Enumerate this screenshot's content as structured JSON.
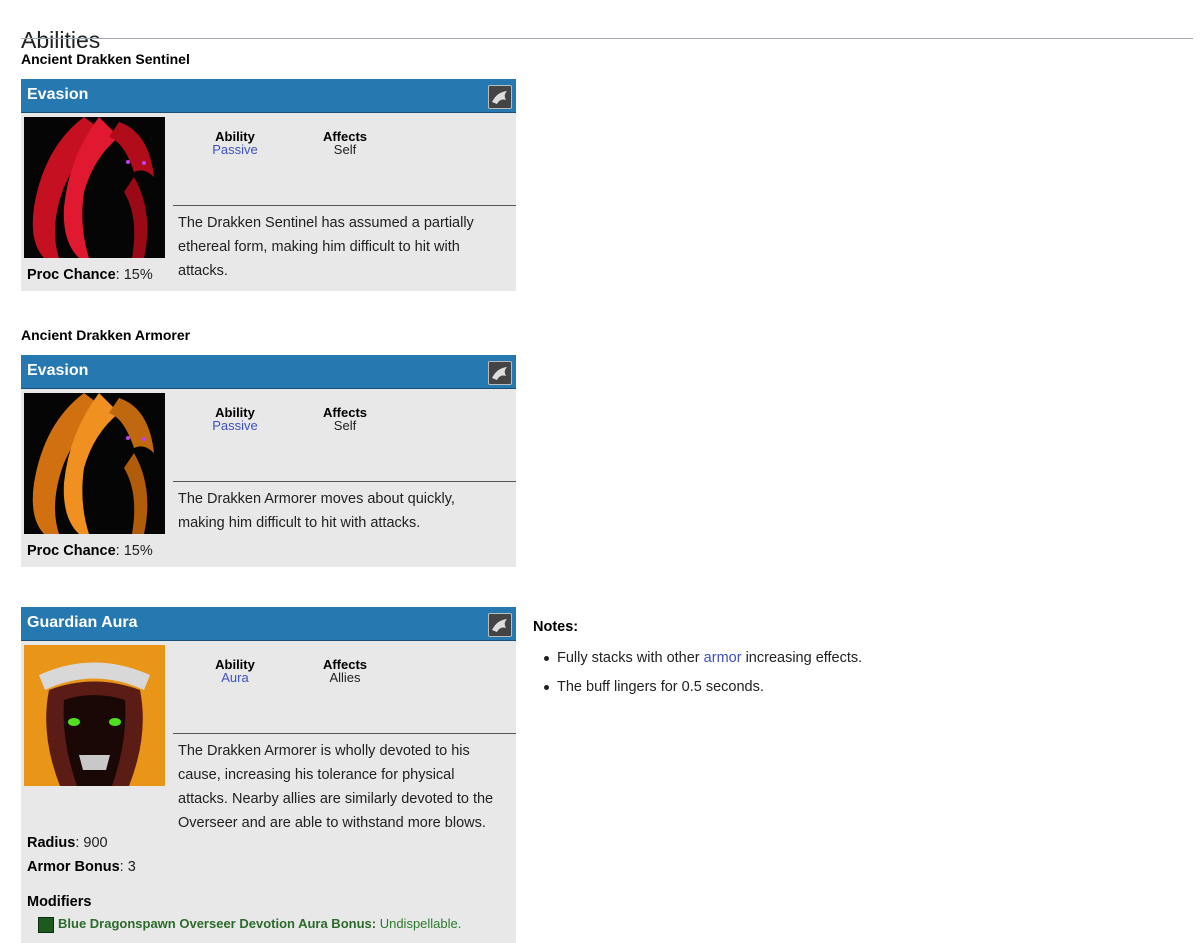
{
  "page": {
    "heading": "Abilities"
  },
  "units": [
    {
      "name": "Ancient Drakken Sentinel",
      "ability": {
        "title": "Evasion",
        "icon": "evasion-red-icon",
        "ability_label": "Ability",
        "ability_value": "Passive",
        "affects_label": "Affects",
        "affects_value": "Self",
        "description": "The Drakken Sentinel has assumed a partially ethereal form, making him difficult to hit with attacks.",
        "props": [
          {
            "label": "Proc Chance",
            "value": ": 15%"
          }
        ]
      }
    },
    {
      "name": "Ancient Drakken Armorer",
      "ability": {
        "title": "Evasion",
        "icon": "evasion-orange-icon",
        "ability_label": "Ability",
        "ability_value": "Passive",
        "affects_label": "Affects",
        "affects_value": "Self",
        "description": "The Drakken Armorer moves about quickly, making him difficult to hit with attacks.",
        "props": [
          {
            "label": "Proc Chance",
            "value": ": 15%"
          }
        ]
      }
    }
  ],
  "guardian": {
    "title": "Guardian Aura",
    "icon": "guardian-aura-icon",
    "ability_label": "Ability",
    "ability_value": "Aura",
    "affects_label": "Affects",
    "affects_value": "Allies",
    "description": "The Drakken Armorer is wholly devoted to his cause, increasing his tolerance for physical attacks. Nearby allies are similarly devoted to the Overseer and are able to withstand more blows.",
    "props": [
      {
        "label": "Radius",
        "value": ": 900"
      },
      {
        "label": "Armor Bonus",
        "value": ": 3"
      }
    ],
    "modifiers_label": "Modifiers",
    "modifier": {
      "name": "Blue Dragonspawn Overseer Devotion Aura Bonus:",
      "value": " Undispellable."
    }
  },
  "notes": {
    "title": "Notes:",
    "items": [
      {
        "before": "Fully stacks with other ",
        "link": "armor",
        "after": " increasing effects."
      },
      {
        "before": "The buff lingers for 0.5 seconds.",
        "link": "",
        "after": ""
      }
    ]
  },
  "colors": {
    "header_blue": "#2578b0",
    "panel_gray": "#e8e8e8",
    "link_blue": "#3d50c0",
    "modifier_green": "#2c7a2c"
  }
}
